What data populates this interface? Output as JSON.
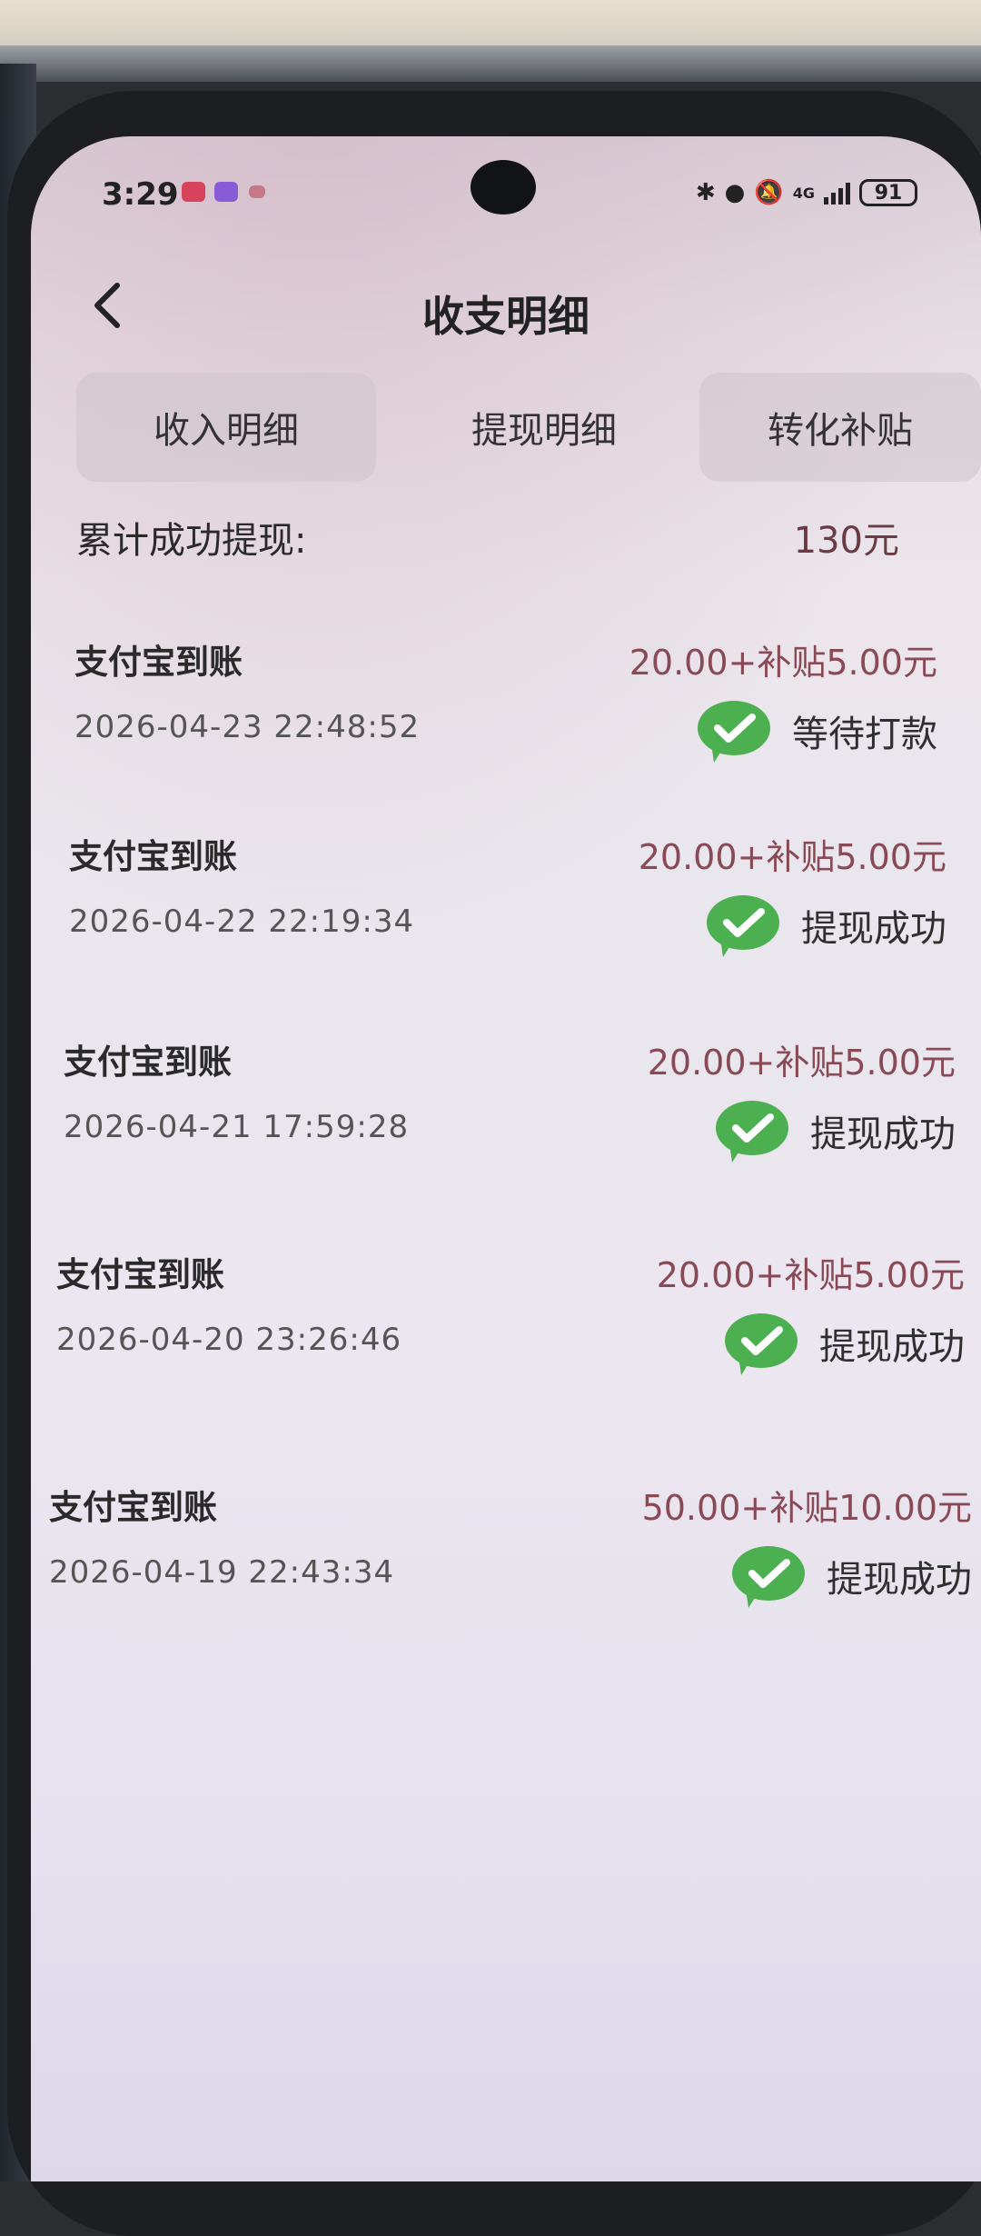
{
  "status_bar": {
    "time": "3:29",
    "network": "4G",
    "battery": "91"
  },
  "header": {
    "back_icon": "chevron-left-icon",
    "title": "收支明细"
  },
  "tabs": [
    {
      "label": "收入明细"
    },
    {
      "label": "提现明细"
    },
    {
      "label": "转化补贴"
    }
  ],
  "summary": {
    "label": "累计成功提现:",
    "value": "130元"
  },
  "records": [
    {
      "method": "支付宝到账",
      "time": "2026-04-23 22:48:52",
      "amount": "20.00+补贴5.00元",
      "status": "等待打款",
      "icon": "wechat-check-icon"
    },
    {
      "method": "支付宝到账",
      "time": "2026-04-22 22:19:34",
      "amount": "20.00+补贴5.00元",
      "status": "提现成功",
      "icon": "wechat-check-icon"
    },
    {
      "method": "支付宝到账",
      "time": "2026-04-21 17:59:28",
      "amount": "20.00+补贴5.00元",
      "status": "提现成功",
      "icon": "wechat-check-icon"
    },
    {
      "method": "支付宝到账",
      "time": "2026-04-20 23:26:46",
      "amount": "20.00+补贴5.00元",
      "status": "提现成功",
      "icon": "wechat-check-icon"
    },
    {
      "method": "支付宝到账",
      "time": "2026-04-19 22:43:34",
      "amount": "50.00+补贴10.00元",
      "status": "提现成功",
      "icon": "wechat-check-icon"
    }
  ],
  "colors": {
    "wechat_green": "#4caf50",
    "amount_red": "#8a4a55",
    "summary_value": "#6a3b45"
  }
}
